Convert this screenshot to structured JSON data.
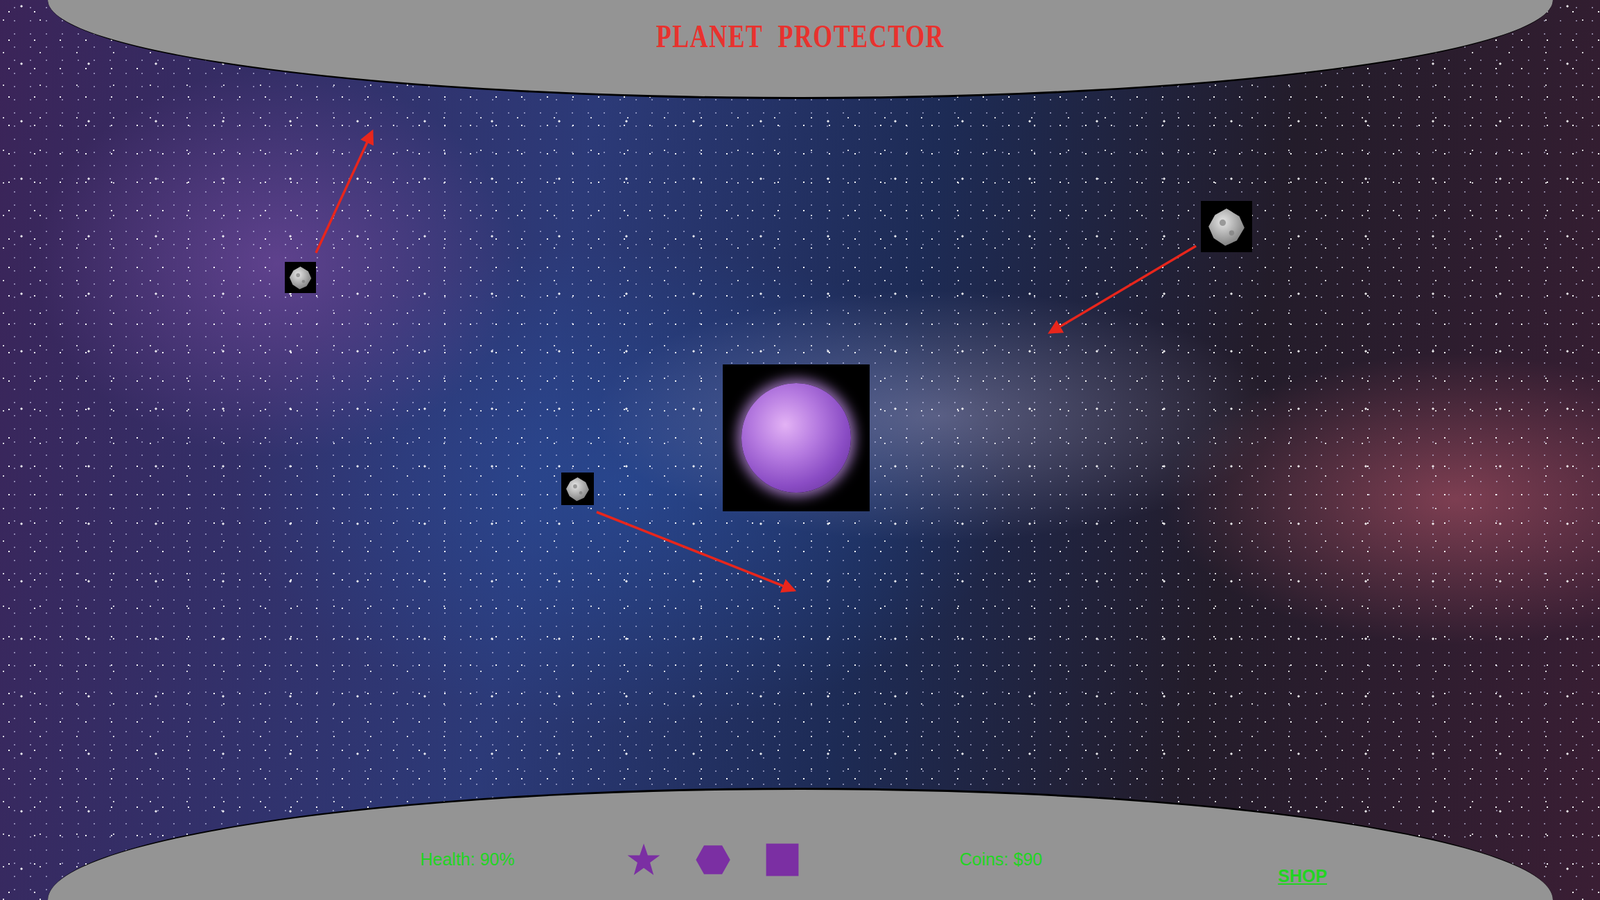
{
  "title": "PLANET PROTECTOR",
  "hud": {
    "health": "Health: 90%",
    "abilities": [
      {
        "kind": "star"
      },
      {
        "kind": "hexagon"
      },
      {
        "kind": "square"
      }
    ],
    "coins": "Coins: $90",
    "shop": "SHOP"
  }
}
